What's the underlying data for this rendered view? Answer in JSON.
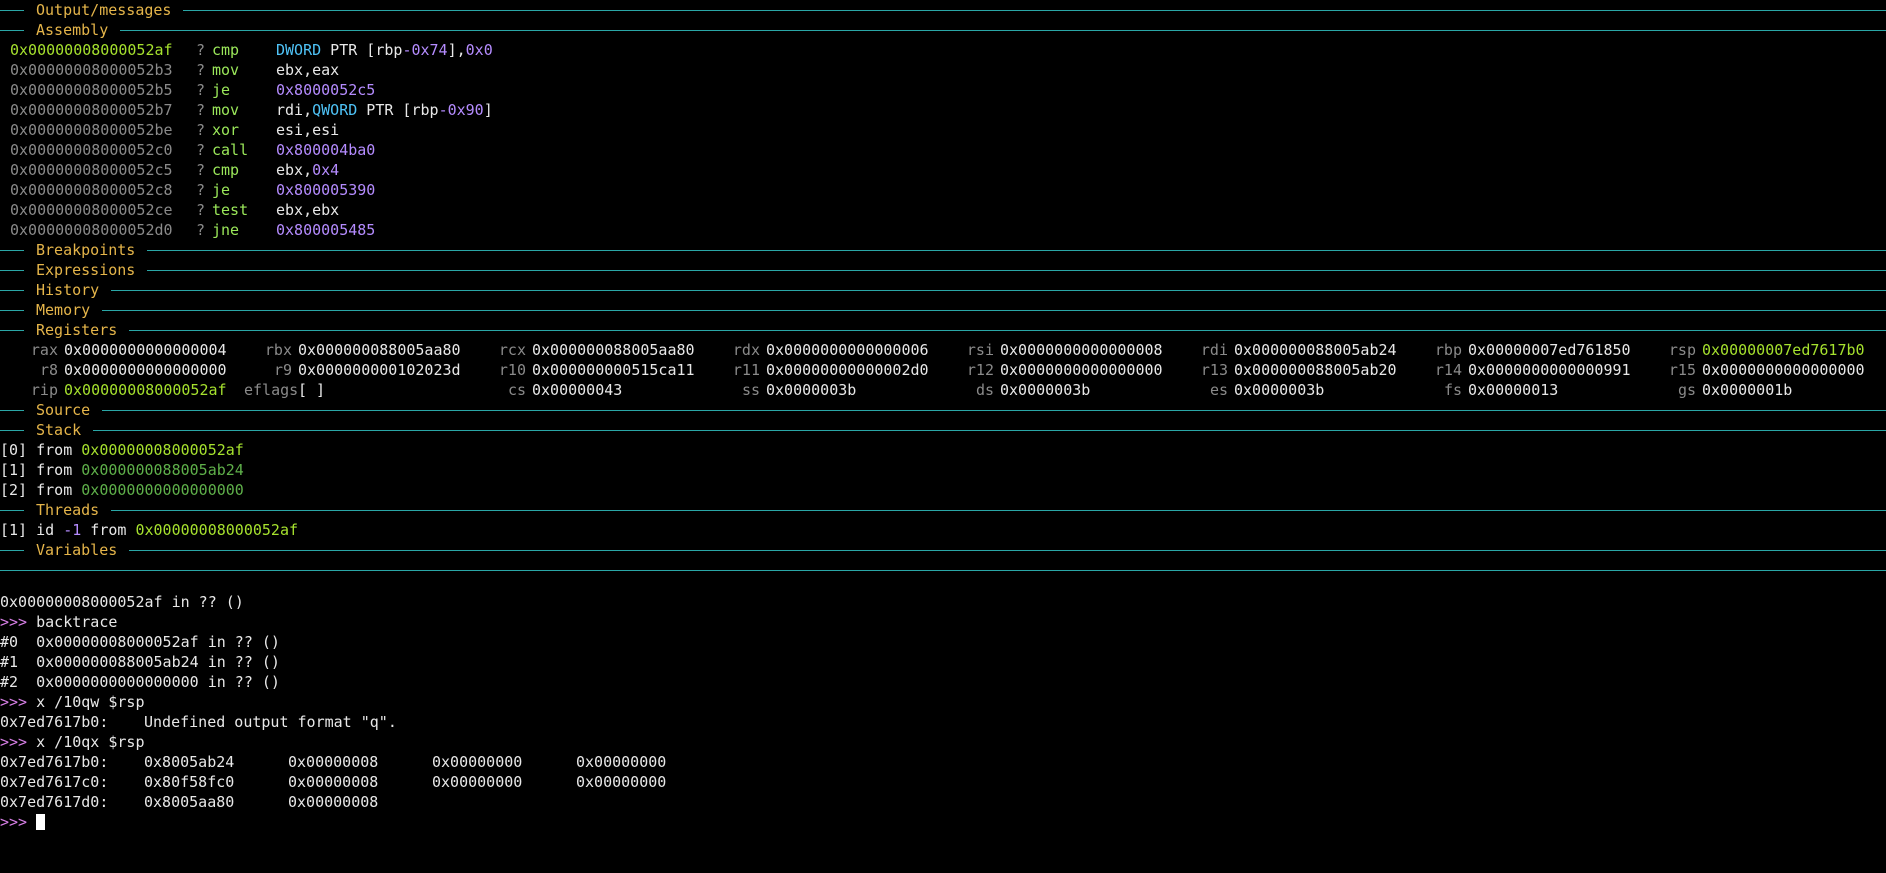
{
  "sections": {
    "output": "Output/messages",
    "assembly": "Assembly",
    "breakpoints": "Breakpoints",
    "expressions": "Expressions",
    "history": "History",
    "memory": "Memory",
    "registers": "Registers",
    "source": "Source",
    "stack": "Stack",
    "threads": "Threads",
    "variables": "Variables"
  },
  "assembly": [
    {
      "addr": "0x00000008000052af",
      "q": "?",
      "mn": "cmp",
      "op1": "DWORD",
      "op2": " PTR [rbp",
      "op3": "-0x74",
      "op4": "],",
      "op5": "0x0",
      "current": true
    },
    {
      "addr": "0x00000008000052b3",
      "q": "?",
      "mn": "mov",
      "ops": "ebx,eax"
    },
    {
      "addr": "0x00000008000052b5",
      "q": "?",
      "mn": "je",
      "num": "0x8000052c5"
    },
    {
      "addr": "0x00000008000052b7",
      "q": "?",
      "mn": "mov",
      "op1": "rdi,",
      "op2": "QWORD",
      "op3": " PTR [rbp",
      "op4": "-0x90",
      "op5": "]"
    },
    {
      "addr": "0x00000008000052be",
      "q": "?",
      "mn": "xor",
      "ops": "esi,esi"
    },
    {
      "addr": "0x00000008000052c0",
      "q": "?",
      "mn": "call",
      "num": "0x800004ba0"
    },
    {
      "addr": "0x00000008000052c5",
      "q": "?",
      "mn": "cmp",
      "op1": "ebx,",
      "op2": "0x4"
    },
    {
      "addr": "0x00000008000052c8",
      "q": "?",
      "mn": "je",
      "num": "0x800005390"
    },
    {
      "addr": "0x00000008000052ce",
      "q": "?",
      "mn": "test",
      "ops": "ebx,ebx"
    },
    {
      "addr": "0x00000008000052d0",
      "q": "?",
      "mn": "jne",
      "num": "0x800005485"
    }
  ],
  "registers": [
    [
      {
        "n": "rax",
        "v": "0x0000000000000004"
      },
      {
        "n": "rbx",
        "v": "0x000000088005aa80"
      },
      {
        "n": "rcx",
        "v": "0x000000088005aa80"
      },
      {
        "n": "rdx",
        "v": "0x0000000000000006"
      },
      {
        "n": "rsi",
        "v": "0x0000000000000008"
      },
      {
        "n": "rdi",
        "v": "0x000000088005ab24"
      },
      {
        "n": "rbp",
        "v": "0x00000007ed761850"
      },
      {
        "n": "rsp",
        "v": "0x00000007ed7617b0",
        "hl": true
      }
    ],
    [
      {
        "n": "r8",
        "v": "0x0000000000000000"
      },
      {
        "n": "r9",
        "v": "0x000000000102023d"
      },
      {
        "n": "r10",
        "v": "0x000000000515ca11"
      },
      {
        "n": "r11",
        "v": "0x00000000000002d0"
      },
      {
        "n": "r12",
        "v": "0x0000000000000000"
      },
      {
        "n": "r13",
        "v": "0x000000088005ab20"
      },
      {
        "n": "r14",
        "v": "0x0000000000000991"
      },
      {
        "n": "r15",
        "v": "0x0000000000000000"
      }
    ],
    [
      {
        "n": "rip",
        "v": "0x00000008000052af",
        "hl": true
      },
      {
        "n": "eflags",
        "v": "[ ]"
      },
      {
        "n": "cs",
        "v": "0x00000043"
      },
      {
        "n": "ss",
        "v": "0x0000003b"
      },
      {
        "n": "ds",
        "v": "0x0000003b"
      },
      {
        "n": "es",
        "v": "0x0000003b"
      },
      {
        "n": "fs",
        "v": "0x00000013"
      },
      {
        "n": "gs",
        "v": "0x0000001b"
      }
    ]
  ],
  "stack": [
    {
      "idx": "[0]",
      "from": " from ",
      "addr": "0x00000008000052af",
      "bright": true
    },
    {
      "idx": "[1]",
      "from": " from ",
      "addr": "0x000000088005ab24"
    },
    {
      "idx": "[2]",
      "from": " from ",
      "addr": "0x0000000000000000"
    }
  ],
  "threads": {
    "idx": "[1]",
    "id": " id ",
    "num": "-1",
    "from": " from ",
    "addr": "0x00000008000052af"
  },
  "console": {
    "line0": "0x00000008000052af in ?? ()",
    "prompt": ">>> ",
    "cmd1": "backtrace",
    "bt": [
      "#0  0x00000008000052af in ?? ()",
      "#1  0x000000088005ab24 in ?? ()",
      "#2  0x0000000000000000 in ?? ()"
    ],
    "cmd2": "x /10qw $rsp",
    "err_addr": "0x7ed7617b0:",
    "err_msg": "Undefined output format \"q\".",
    "cmd3": "x /10qx $rsp",
    "mem": [
      {
        "a": "0x7ed7617b0:",
        "v": [
          "0x8005ab24",
          "0x00000008",
          "0x00000000",
          "0x00000000"
        ]
      },
      {
        "a": "0x7ed7617c0:",
        "v": [
          "0x80f58fc0",
          "0x00000008",
          "0x00000000",
          "0x00000000"
        ]
      },
      {
        "a": "0x7ed7617d0:",
        "v": [
          "0x8005aa80",
          "0x00000008"
        ]
      }
    ]
  }
}
